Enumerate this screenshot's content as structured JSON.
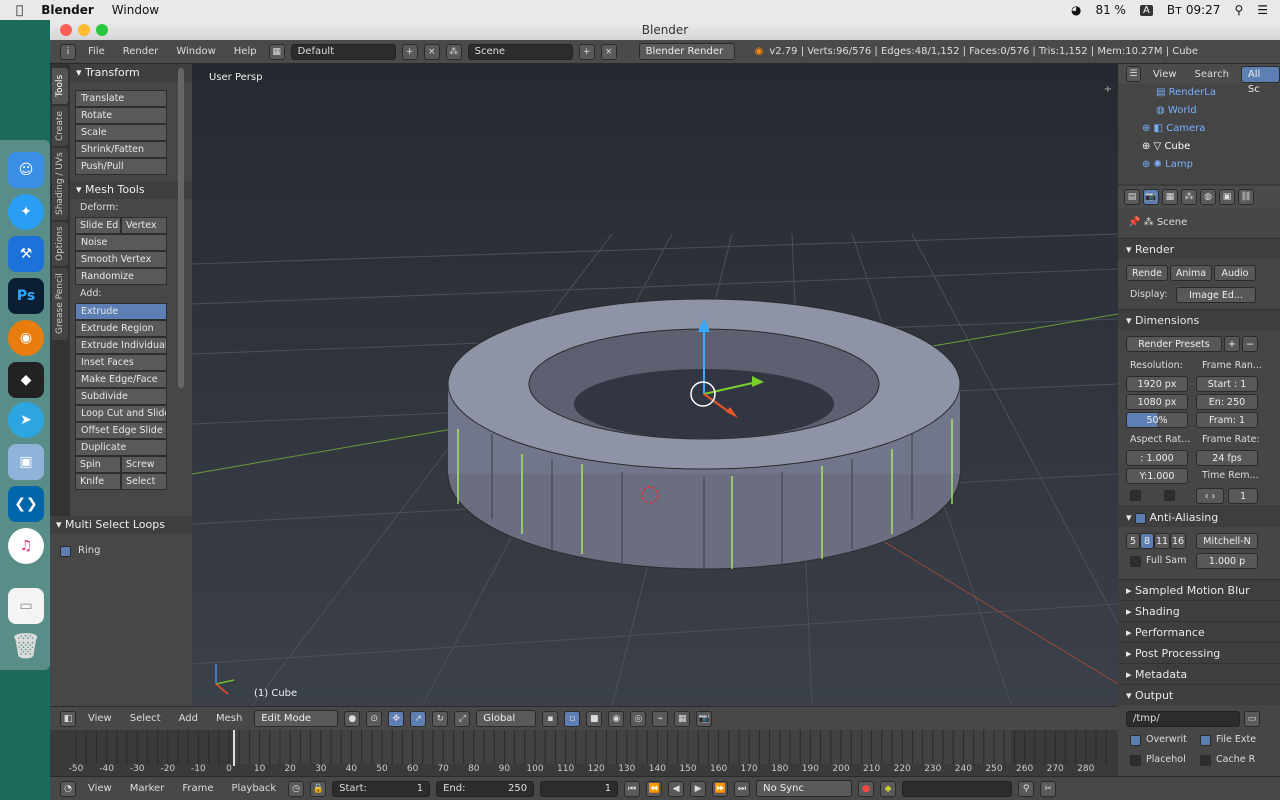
{
  "macbar": {
    "app": "Blender",
    "menu": "Window",
    "battery": "81 %",
    "input": "A",
    "clock": "Вт 09:27"
  },
  "window": {
    "title": "Blender"
  },
  "info": {
    "menus": [
      "File",
      "Render",
      "Window",
      "Help"
    ],
    "layout": "Default",
    "scene": "Scene",
    "engine": "Blender Render",
    "stats": "v2.79 | Verts:96/576 | Edges:48/1,152 | Faces:0/576 | Tris:1,152 | Mem:10.27M | Cube"
  },
  "tabs": [
    "Tools",
    "Create",
    "Shading / UVs",
    "Options",
    "Grease Pencil"
  ],
  "transform": {
    "title": "Transform",
    "items": [
      "Translate",
      "Rotate",
      "Scale",
      "Shrink/Fatten",
      "Push/Pull"
    ]
  },
  "meshtools": {
    "title": "Mesh Tools",
    "deform": "Deform:",
    "slide_ed": "Slide Ed",
    "vertex": "Vertex",
    "noise": "Noise",
    "smooth": "Smooth Vertex",
    "randomize": "Randomize",
    "add": "Add:",
    "extrude": "Extrude",
    "items": [
      "Extrude Region",
      "Extrude Individual",
      "Inset Faces",
      "Make Edge/Face",
      "Subdivide",
      "Loop Cut and Slide",
      "Offset Edge Slide",
      "Duplicate"
    ],
    "spin": "Spin",
    "screw": "Screw",
    "knife": "Knife",
    "select": "Select"
  },
  "msl": {
    "title": "Multi Select Loops",
    "ring": "Ring"
  },
  "viewport": {
    "view": "User Persp",
    "object": "(1) Cube"
  },
  "outliner": {
    "view": "View",
    "search": "Search",
    "all": "All Sc",
    "items": [
      "RenderLa",
      "World",
      "Camera",
      "Cube",
      "Lamp"
    ]
  },
  "props": {
    "scene": "Scene",
    "render": "Render",
    "rende": "Rende",
    "anima": "Anima",
    "audio": "Audio",
    "display": "Display:",
    "display_val": "Image Ed...",
    "dimensions": "Dimensions",
    "presets": "Render Presets",
    "resolution": "Resolution:",
    "frame_range": "Frame Ran...",
    "resx": "1920 px",
    "resy": "1080 px",
    "pct": "50%",
    "start": "Start : 1",
    "end": "En: 250",
    "frame": "Fram: 1",
    "aspect": "Aspect Rat...",
    "framerate": "Frame Rate:",
    "ax": ": 1.000",
    "ay": "Y:1.000",
    "fps": "24 fps",
    "timerem": "Time Rem...",
    "tr1": "1",
    "aa": "Anti-Aliasing",
    "s5": "5",
    "s8": "8",
    "s11": "11",
    "s16": "16",
    "filter": "Mitchell-N",
    "fullsam": "Full Sam",
    "fs_val": "1.000 p",
    "panels": [
      "Sampled Motion Blur",
      "Shading",
      "Performance",
      "Post Processing",
      "Metadata",
      "Output"
    ],
    "path": "/tmp/",
    "overwrite": "Overwrit",
    "fileext": "File Exte",
    "placehol": "Placehol",
    "cache": "Cache R"
  },
  "vphead": {
    "menus": [
      "View",
      "Select",
      "Add",
      "Mesh"
    ],
    "mode": "Edit Mode",
    "orient": "Global"
  },
  "timeline": {
    "ticks": [
      "-50",
      "-40",
      "-30",
      "-20",
      "-10",
      "0",
      "10",
      "20",
      "30",
      "40",
      "50",
      "60",
      "70",
      "80",
      "90",
      "100",
      "110",
      "120",
      "130",
      "140",
      "150",
      "160",
      "170",
      "180",
      "190",
      "200",
      "210",
      "220",
      "230",
      "240",
      "250",
      "260",
      "270",
      "280"
    ]
  },
  "tlhead": {
    "menus": [
      "View",
      "Marker",
      "Frame",
      "Playback"
    ],
    "start": "Start:",
    "start_val": "1",
    "end": "End:",
    "end_val": "250",
    "frame": "1",
    "sync": "No Sync"
  }
}
